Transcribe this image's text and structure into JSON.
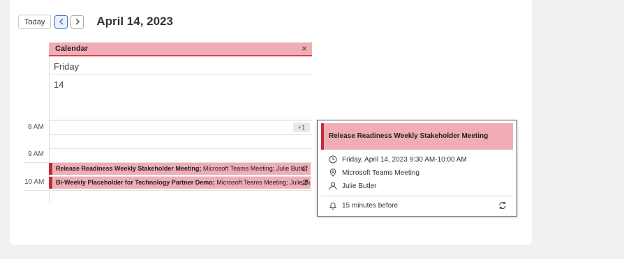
{
  "toolbar": {
    "today_label": "Today",
    "date_title": "April 14, 2023"
  },
  "calendar": {
    "name": "Calendar",
    "close_glyph": "×",
    "day_name": "Friday",
    "day_number": "14",
    "more_badge": "+1"
  },
  "time_labels": [
    "8 AM",
    "9 AM",
    "10 AM"
  ],
  "events": [
    {
      "title": "Release Readiness Weekly Stakeholder Meeting;",
      "location": " Microsoft Teams Meeting; Julie Butler"
    },
    {
      "title": "Bi-Weekly Placeholder for Technology Partner Demo;",
      "location": " Microsoft Teams Meeting; Julie Butler"
    }
  ],
  "popup": {
    "title": "Release Readiness Weekly Stakeholder Meeting",
    "time": "Friday, April 14, 2023 9:30 AM-10:00 AM",
    "location": "Microsoft Teams Meeting",
    "organizer": "Julie Butler",
    "reminder": "15 minutes before"
  },
  "colors": {
    "event_fill": "#f0adb5",
    "event_accent": "#c5283d",
    "nav_active": "#2e6fb7"
  },
  "icons": [
    "chevron-left-icon",
    "chevron-right-icon",
    "close-icon",
    "recurring-icon",
    "clock-icon",
    "location-pin-icon",
    "person-icon",
    "bell-icon",
    "sync-icon"
  ]
}
